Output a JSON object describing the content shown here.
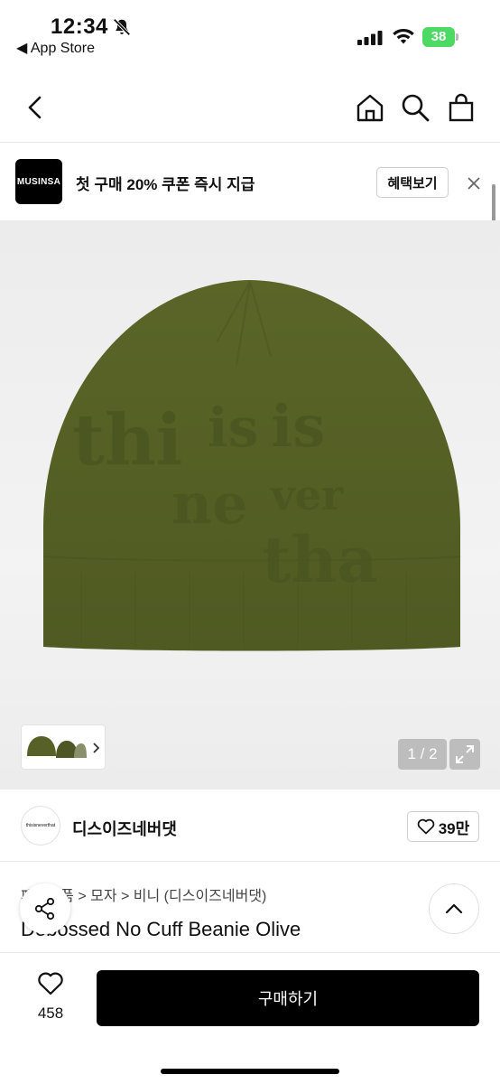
{
  "status_bar": {
    "time": "12:34",
    "back_label": "◀ App Store",
    "battery": "38"
  },
  "banner": {
    "logo_text": "MUSINSA",
    "text": "첫 구매 20% 쿠폰 즉시 지급",
    "benefit_label": "혜택보기"
  },
  "gallery": {
    "counter": "1 / 2"
  },
  "brand": {
    "logo_text": "thisisneverthat",
    "name": "디스이즈네버댓",
    "likes": "39만"
  },
  "product": {
    "breadcrumb": "패션소품 > 모자 > 비니 (디스이즈네버댓)",
    "title": "Debossed No Cuff Beanie Olive"
  },
  "bottom_bar": {
    "wish_count": "458",
    "buy_label": "구매하기"
  },
  "colors": {
    "beanie": "#566027",
    "accent": "#000000",
    "battery": "#4cd964"
  }
}
